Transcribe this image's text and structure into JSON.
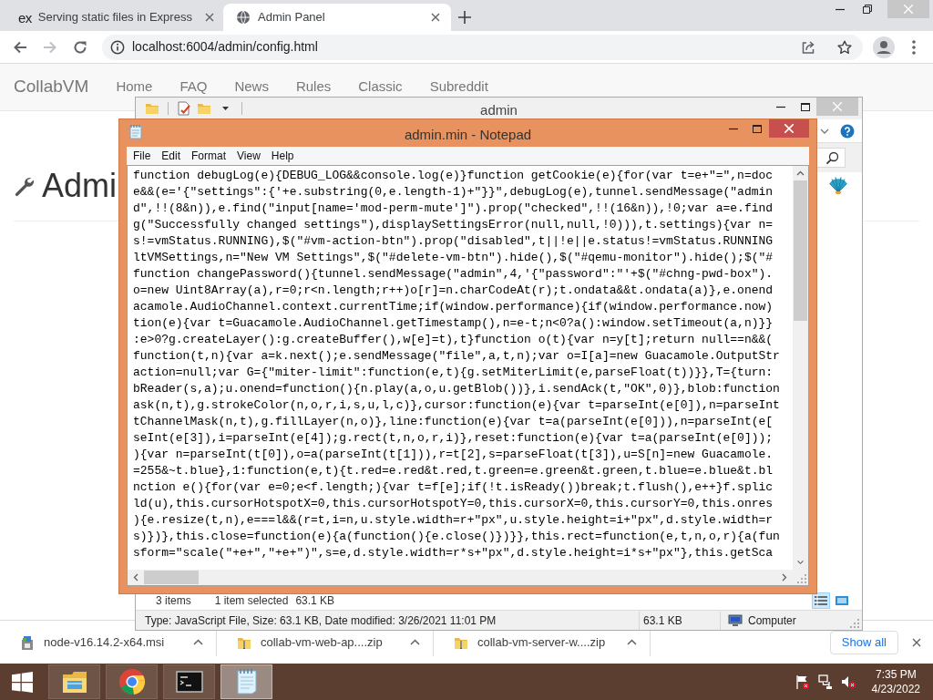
{
  "browser": {
    "tabs": [
      {
        "favicon_text": "ex",
        "title": "Serving static files in Express",
        "selected": false
      },
      {
        "title": "Admin Panel",
        "selected": true
      }
    ],
    "nav_buttons": [
      {
        "kind": "back",
        "disabled": false
      },
      {
        "kind": "forward",
        "disabled": true
      },
      {
        "kind": "reload",
        "disabled": false
      }
    ],
    "address": "localhost:6004/admin/config.html"
  },
  "page": {
    "brand": "CollabVM",
    "links": [
      "Home",
      "FAQ",
      "News",
      "Rules",
      "Classic",
      "Subreddit"
    ],
    "heading": "Admi"
  },
  "explorer": {
    "title": "admin",
    "status": [
      "3 items",
      "1 item selected",
      "63.1 KB"
    ],
    "details": [
      "Type: JavaScript File, Size: 63.1 KB, Date modified: 3/26/2021 11:01 PM",
      "63.1 KB"
    ],
    "zone": "Computer",
    "views": [
      {
        "kind": "details",
        "selected": true
      },
      {
        "kind": "large_icons",
        "selected": false
      }
    ]
  },
  "notepad": {
    "title": "admin.min - Notepad",
    "menu": [
      "File",
      "Edit",
      "Format",
      "View",
      "Help"
    ],
    "lines": [
      "function debugLog(e){DEBUG_LOG&&console.log(e)}function getCookie(e){for(var t=e+\"=\",n=doc",
      "e&&(e='{\"settings\":{'+e.substring(0,e.length-1)+\"}}\",debugLog(e),tunnel.sendMessage(\"admin",
      "d\",!!(8&n)),e.find(\"input[name='mod-perm-mute']\").prop(\"checked\",!!(16&n)),!0;var a=e.find",
      "g(\"Successfully changed settings\"),displaySettingsError(null,null,!0))),t.settings){var n=",
      "s!=vmStatus.RUNNING),$(\"#vm-action-btn\").prop(\"disabled\",t||!e||e.status!=vmStatus.RUNNING",
      "ltVMSettings,n=\"New VM Settings\",$(\"#delete-vm-btn\").hide(),$(\"#qemu-monitor\").hide();$(\"#",
      "function changePassword(){tunnel.sendMessage(\"admin\",4,'{\"password\":\"'+$(\"#chng-pwd-box\").",
      "o=new Uint8Array(a),r=0;r<n.length;r++)o[r]=n.charCodeAt(r);t.ondata&&t.ondata(a)},e.onend",
      "acamole.AudioChannel.context.currentTime;if(window.performance){if(window.performance.now)",
      "tion(e){var t=Guacamole.AudioChannel.getTimestamp(),n=e-t;n<0?a():window.setTimeout(a,n)}}",
      ":e>0?g.createLayer():g.createBuffer(),w[e]=t),t}function o(t){var n=y[t];return null==n&&(",
      "function(t,n){var a=k.next();e.sendMessage(\"file\",a,t,n);var o=I[a]=new Guacamole.OutputStr",
      "action=null;var G={\"miter-limit\":function(e,t){g.setMiterLimit(e,parseFloat(t))}},T={turn:",
      "bReader(s,a);u.onend=function(){n.play(a,o,u.getBlob())},i.sendAck(t,\"OK\",0)},blob:function",
      "ask(n,t),g.strokeColor(n,o,r,i,s,u,l,c)},cursor:function(e){var t=parseInt(e[0]),n=parseInt",
      "tChannelMask(n,t),g.fillLayer(n,o)},line:function(e){var t=a(parseInt(e[0])),n=parseInt(e[",
      "seInt(e[3]),i=parseInt(e[4]);g.rect(t,n,o,r,i)},reset:function(e){var t=a(parseInt(e[0]));",
      "){var n=parseInt(t[0]),o=a(parseInt(t[1])),r=t[2],s=parseFloat(t[3]),u=S[n]=new Guacamole.",
      "=255&~t.blue},1:function(e,t){t.red=e.red&t.red,t.green=e.green&t.green,t.blue=e.blue&t.bl",
      "nction e(){for(var e=0;e<f.length;){var t=f[e];if(!t.isReady())break;t.flush(),e++}f.splic",
      "ld(u),this.cursorHotspotX=0,this.cursorHotspotY=0,this.cursorX=0,this.cursorY=0,this.onres",
      "){e.resize(t,n),e===l&&(r=t,i=n,u.style.width=r+\"px\",u.style.height=i+\"px\",d.style.width=r",
      "s)})},this.close=function(e){a(function(){e.close()})}},this.rect=function(e,t,n,o,r){a(fun",
      "sform=\"scale(\"+e+\",\"+e+\")\",s=e,d.style.width=r*s+\"px\",d.style.height=i*s+\"px\"},this.getSca"
    ]
  },
  "downloads": {
    "items": [
      {
        "kind": "msi",
        "name": "node-v16.14.2-x64.msi"
      },
      {
        "kind": "zip",
        "name": "collab-vm-web-ap....zip"
      },
      {
        "kind": "zip",
        "name": "collab-vm-server-w....zip"
      }
    ],
    "show_all": "Show all"
  },
  "taskbar": {
    "apps": [
      {
        "kind": "explorer",
        "active": false
      },
      {
        "kind": "browser",
        "active": false
      },
      {
        "kind": "terminal",
        "active": false
      },
      {
        "kind": "notepad",
        "active": true
      }
    ],
    "time": "7:35 PM",
    "date": "4/23/2022"
  }
}
